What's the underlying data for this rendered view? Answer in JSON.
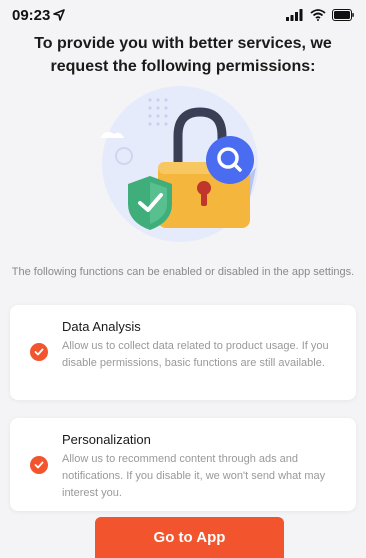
{
  "status_bar": {
    "time": "09:23"
  },
  "header": {
    "title": "To provide you with better services, we request the following permissions:"
  },
  "hero": {
    "illustration": "padlock-with-shield-and-search-icon"
  },
  "subtitle": "The following functions can be enabled or disabled in the app settings.",
  "permissions": [
    {
      "title": "Data Analysis",
      "description": "Allow us to collect data related to product usage. If you disable permissions, basic functions are still available.",
      "checked": true
    },
    {
      "title": "Personalization",
      "description": "Allow us to recommend content through ads and notifications. If you disable it, we won't send what may interest you.",
      "checked": true
    }
  ],
  "actions": {
    "go_label": "Go to App"
  },
  "colors": {
    "accent": "#f2542d",
    "lock_body": "#f4b63c",
    "shield": "#3fae7a",
    "search_badge": "#4a6cf0"
  }
}
